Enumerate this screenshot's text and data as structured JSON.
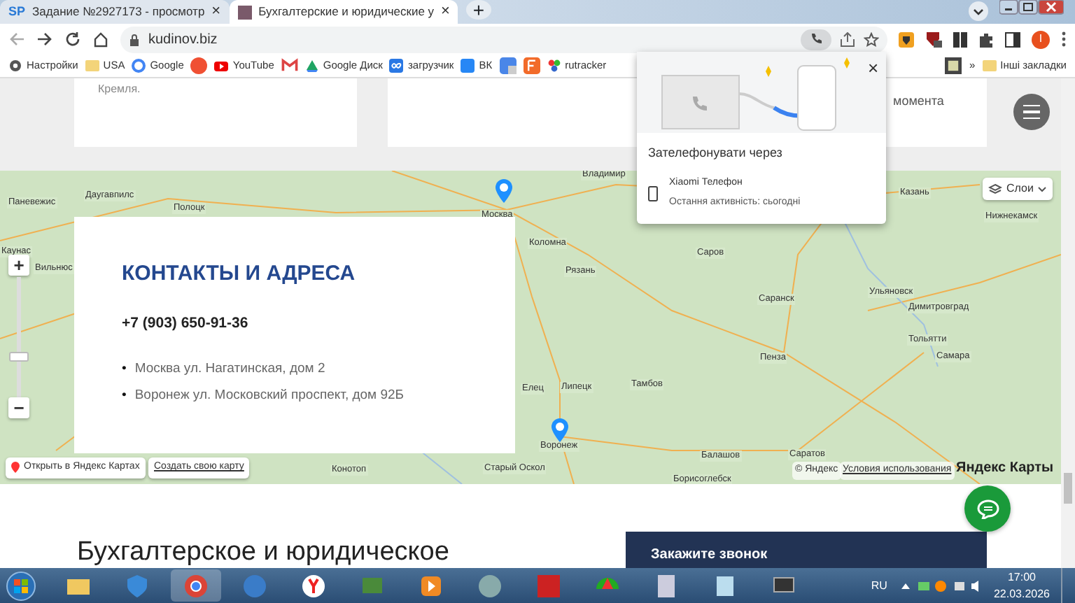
{
  "tabs": [
    {
      "favicon": "SP",
      "title": "Задание №2927173 - просмотр",
      "close": "×",
      "selected": false
    },
    {
      "title": "Бухгалтерские и юридические у",
      "close": "×",
      "selected": true
    }
  ],
  "new_tab": "+",
  "address_bar": {
    "url": "kudinov.biz"
  },
  "profile": {
    "letter": "I"
  },
  "bookmarks": [
    {
      "label": "Настройки"
    },
    {
      "label": "USA"
    },
    {
      "label": "Google"
    },
    {
      "kind": "icon"
    },
    {
      "label": "YouTube"
    },
    {
      "kind": "icon"
    },
    {
      "label": "Google Диск"
    },
    {
      "label": "загрузчик"
    },
    {
      "label": "ВК"
    },
    {
      "kind": "icon"
    },
    {
      "kind": "icon"
    },
    {
      "label": "rutracker"
    },
    {
      "kind": "icon"
    }
  ],
  "bookmarks_more": "»",
  "other_bookmarks": "Інші закладки",
  "call_popup": {
    "close": "×",
    "title": "Зателефонувати через",
    "device": "Xiaomi Телефон",
    "activity": "Остання активність: сьогодні"
  },
  "top_cards": [
    {
      "text": "Кремля."
    },
    {
      "text": "момента"
    }
  ],
  "map": {
    "layers_button": "Слои",
    "zoom_in": "+",
    "zoom_out": "−",
    "open_link": "Открыть в Яндекс Картах",
    "create_link": "Создать свою карту",
    "copyright": "© Яндекс",
    "terms": "Условия использования",
    "brand": "Яндекс Карты",
    "labels": [
      "Владимир",
      "Москва",
      "Даугавпилс",
      "Паневежис",
      "Полоцк",
      "Коломна",
      "Рязань",
      "Каунас",
      "Вильнюс",
      "Казань",
      "Нижнекамск",
      "Саров",
      "Саранск",
      "Ульяновск",
      "Димитровград",
      "Тольятти",
      "Самара",
      "Пенза",
      "Тамбов",
      "Елец",
      "Липецк",
      "Воронеж",
      "Балашов",
      "Саратов",
      "Конотоп",
      "Старый Оскол",
      "Борисоглебск"
    ]
  },
  "contacts": {
    "title": "КОНТАКТЫ И АДРЕСА",
    "phone": "+7 (903) 650-91-36",
    "addresses": [
      {
        "bullet": "•",
        "text": "Москва ул. Нагатинская, дом 2"
      },
      {
        "bullet": "•",
        "text": "Воронеж ул. Московский проспект, дом 92Б"
      }
    ]
  },
  "section_heading": "Бухгалтерское и юридическое",
  "callback_panel": {
    "title": "Закажите звонок"
  },
  "taskbar": {
    "language": "RU",
    "time": "17:00",
    "date": "22.03.2026"
  }
}
